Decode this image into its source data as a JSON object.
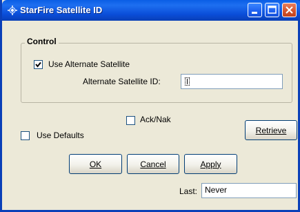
{
  "window": {
    "title": "StarFire Satellite ID",
    "controls": {
      "minimize": "minimize-icon",
      "maximize": "maximize-icon",
      "close": "close-icon"
    }
  },
  "control_group": {
    "label": "Control",
    "use_alternate": {
      "label": "Use Alternate Satellite",
      "checked": true
    },
    "alternate_id": {
      "label": "Alternate Satellite ID:",
      "value": ""
    }
  },
  "options": {
    "ack_nak": {
      "label": "Ack/Nak",
      "checked": false
    },
    "use_defaults": {
      "label": "Use Defaults",
      "checked": false
    }
  },
  "buttons": {
    "retrieve": "Retrieve",
    "ok": "OK",
    "cancel": "Cancel",
    "apply": "Apply"
  },
  "last": {
    "label": "Last:",
    "value": "Never"
  },
  "colors": {
    "title_bar": "#0a5ee5",
    "dialog_bg": "#ece9d8",
    "close_button": "#d2522c"
  }
}
